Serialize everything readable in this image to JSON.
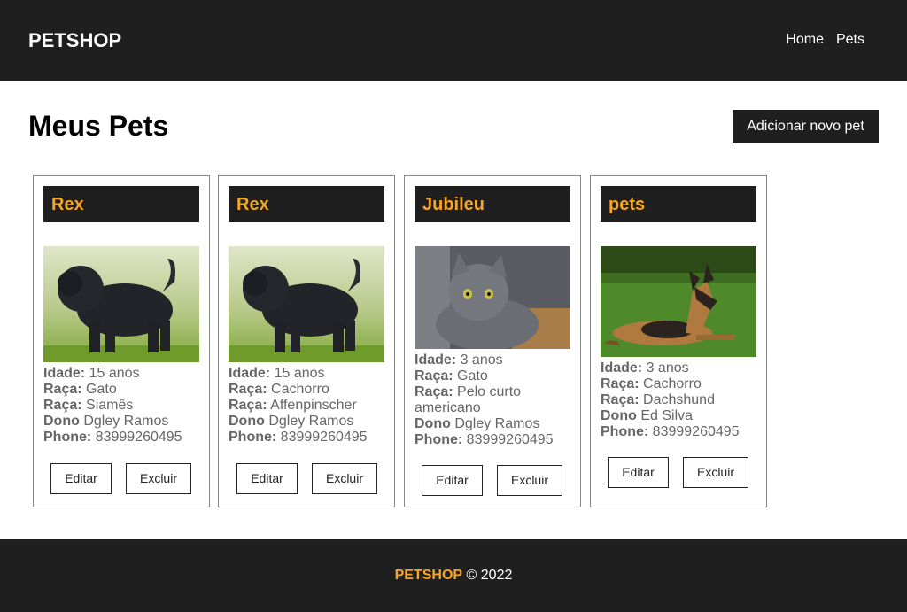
{
  "header": {
    "brand": "PETSHOP",
    "nav": [
      "Home",
      "Pets"
    ]
  },
  "main": {
    "title": "Meus Pets",
    "add_button": "Adicionar novo pet"
  },
  "labels": {
    "age": "Idade:",
    "breed": "Raça:",
    "owner": "Dono",
    "phone": "Phone:",
    "edit": "Editar",
    "delete": "Excluir"
  },
  "pets": [
    {
      "name": "Rex",
      "photo": "black-shaggy-dog-photo",
      "age": "15 anos",
      "breed1": "Gato",
      "breed2": "Siamês",
      "owner": "Dgley Ramos",
      "phone": "83999260495"
    },
    {
      "name": "Rex",
      "photo": "black-shaggy-dog-photo",
      "age": "15 anos",
      "breed1": "Cachorro",
      "breed2": "Affenpinscher",
      "owner": "Dgley Ramos",
      "phone": "83999260495"
    },
    {
      "name": "Jubileu",
      "photo": "gray-cat-photo",
      "age": "3 anos",
      "breed1": "Gato",
      "breed2": "Pelo curto americano",
      "owner": "Dgley Ramos",
      "phone": "83999260495"
    },
    {
      "name": "pets",
      "photo": "german-shepherd-photo",
      "age": "3 anos",
      "breed1": "Cachorro",
      "breed2": "Dachshund",
      "owner": "Ed Silva",
      "phone": "83999260495"
    }
  ],
  "footer": {
    "brand": "PETSHOP",
    "copyright": "© 2022"
  },
  "colors": {
    "dark": "#1f1f1f",
    "accent": "#f5a623",
    "muted_text": "#666666"
  }
}
